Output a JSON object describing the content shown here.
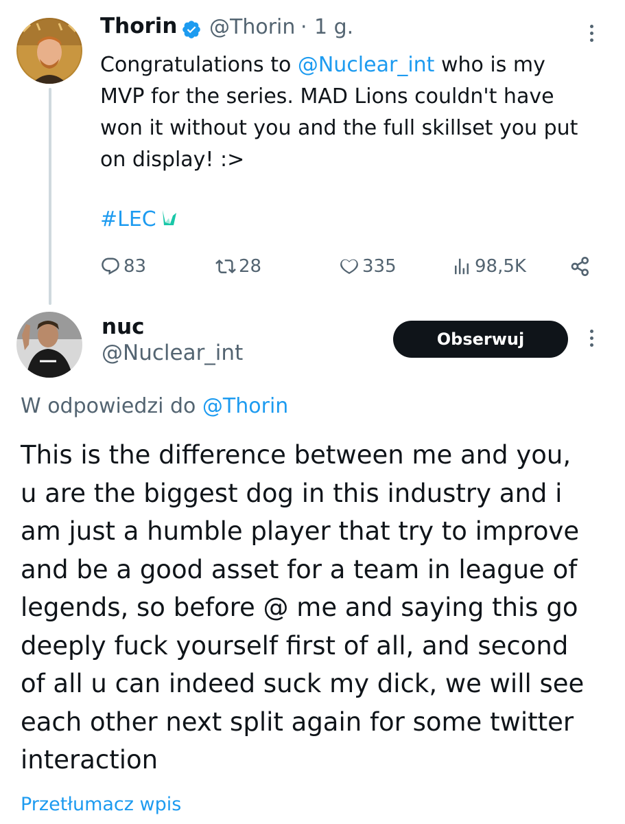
{
  "original_tweet": {
    "author_name": "Thorin",
    "handle": "@Thorin",
    "separator": "·",
    "time": "1 g.",
    "text_before_mention": "Congratulations to ",
    "mention": "@Nuclear_int",
    "text_after_mention": " who is my\nMVP for the series. MAD Lions couldn't have\nwon it without you and the full skillset you put\non display! :>",
    "hashtag": "#LEC",
    "stats": {
      "replies": "83",
      "retweets": "28",
      "likes": "335",
      "views": "98,5K"
    },
    "icons": [
      "verified-badge-icon",
      "reply-icon",
      "retweet-icon",
      "like-icon",
      "views-icon",
      "share-icon",
      "more-options-icon",
      "lec-emoji"
    ]
  },
  "reply_tweet": {
    "author_name": "nuc",
    "handle": "@Nuclear_int",
    "follow_label": "Obserwuj",
    "replying_to_label": "W odpowiedzi do ",
    "replying_to_handle": "@Thorin",
    "text": "This is the difference between me and you,\nu are the biggest dog in this industry and i\nam just a humble player that try to improve\nand be a good asset for a team in league of\nlegends, so before @ me and saying this go\ndeeply fuck yourself first of all, and second\nof all u can indeed suck my dick, we will see\neach other next split again for some twitter\ninteraction",
    "translate_label": "Przetłumacz wpis"
  },
  "colors": {
    "accent": "#1d9bf0",
    "text_primary": "#0f1419",
    "text_secondary": "#536471",
    "thread_line": "#cfd9de",
    "follow_button_bg": "#0f1419",
    "lec_emoji": "#19c7a8"
  }
}
